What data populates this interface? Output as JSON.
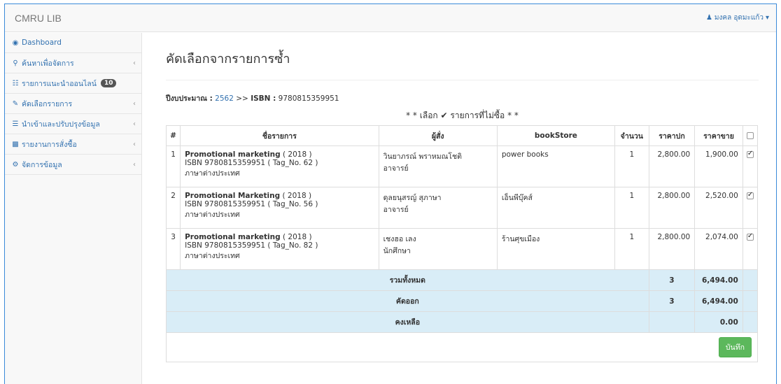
{
  "app": {
    "brand": "CMRU LIB",
    "user_name": "มงคล อุดมะแก้ว"
  },
  "sidebar": {
    "items": [
      {
        "icon": "dashboard-icon",
        "label": "Dashboard",
        "badge": "",
        "has_chevron": false
      },
      {
        "icon": "search-icon",
        "label": "ค้นหาเพื่อจัดการ",
        "badge": "",
        "has_chevron": true
      },
      {
        "icon": "cart-icon",
        "label": "รายการแนะนำออนไลน์",
        "badge": "10",
        "has_chevron": false
      },
      {
        "icon": "edit-icon",
        "label": "คัดเลือกรายการ",
        "badge": "",
        "has_chevron": true
      },
      {
        "icon": "database-icon",
        "label": "นำเข้าและปรับปรุงข้อมูล",
        "badge": "",
        "has_chevron": true
      },
      {
        "icon": "bar-chart-icon",
        "label": "รายงานการสั่งซื้อ",
        "badge": "",
        "has_chevron": true
      },
      {
        "icon": "sliders-icon",
        "label": "จัดการข้อมูล",
        "badge": "",
        "has_chevron": true
      }
    ]
  },
  "page": {
    "title": "คัดเลือกจากรายการซ้ำ",
    "budget_label": "ปีงบประมาณ :",
    "budget_year": "2562",
    "separator": ">>",
    "isbn_label": "ISBN :",
    "isbn_value": "9780815359951",
    "caption_before": "* * เลือก",
    "caption_after": "รายการที่ไม่ซื้อ * *"
  },
  "table": {
    "headers": [
      "#",
      "ชื่อรายการ",
      "ผู้สั่ง",
      "bookStore",
      "จำนวน",
      "ราคาปก",
      "ราคาขาย"
    ],
    "rows": [
      {
        "no": "1",
        "title": "Promotional marketing",
        "year": "( 2018 )",
        "isbn": "ISBN 9780815359951 ( Tag_No. 62 )",
        "lang": "ภาษาต่างประเทศ",
        "orderer": "วินยาภรณ์ พราหมณโชติ",
        "role": "อาจารย์",
        "store": "power books",
        "qty": "1",
        "cover": "2,800.00",
        "sale": "1,900.00",
        "checked": true
      },
      {
        "no": "2",
        "title": "Promotional Marketing",
        "year": "( 2018 )",
        "isbn": "ISBN 9780815359951 ( Tag_No. 56 )",
        "lang": "ภาษาต่างประเทศ",
        "orderer": "ดุลยนุสรญ์ สุภาษา",
        "role": "อาจารย์",
        "store": "เอ็นพีบุ๊คส์",
        "qty": "1",
        "cover": "2,800.00",
        "sale": "2,520.00",
        "checked": true
      },
      {
        "no": "3",
        "title": "Promotional marketing",
        "year": "( 2018 )",
        "isbn": "ISBN 9780815359951 ( Tag_No. 82 )",
        "lang": "ภาษาต่างประเทศ",
        "orderer": "เชงฮอ เลง",
        "role": "นักศึกษา",
        "store": "ร้านศุขเมือง",
        "qty": "1",
        "cover": "2,800.00",
        "sale": "2,074.00",
        "checked": true
      }
    ],
    "summary": [
      {
        "label": "รวมทั้งหมด",
        "count": "3",
        "amount": "6,494.00"
      },
      {
        "label": "คัดออก",
        "count": "3",
        "amount": "6,494.00"
      },
      {
        "label": "คงเหลือ",
        "count": "",
        "amount": "0.00"
      }
    ],
    "save_label": "บันทึก"
  }
}
